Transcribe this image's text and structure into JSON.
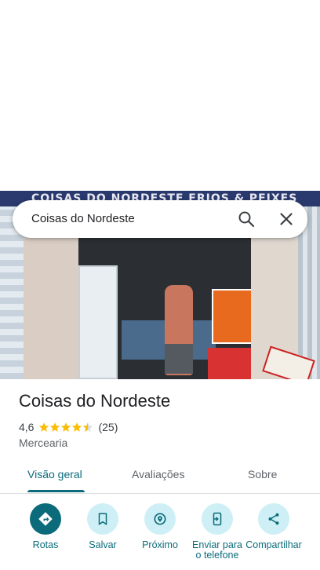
{
  "photo": {
    "sign_text": "COISAS DO NORDESTE FRIOS & PEIXES"
  },
  "search": {
    "query": "Coisas do Nordeste",
    "search_icon": "search-icon",
    "close_icon": "close-icon"
  },
  "place": {
    "title": "Coisas do Nordeste",
    "rating": "4,6",
    "stars": 4.5,
    "reviews": "(25)",
    "category": "Mercearia"
  },
  "tabs": [
    {
      "label": "Visão geral",
      "active": true
    },
    {
      "label": "Avaliações",
      "active": false
    },
    {
      "label": "Sobre",
      "active": false
    }
  ],
  "actions": [
    {
      "label": "Rotas",
      "icon": "directions-icon"
    },
    {
      "label": "Salvar",
      "icon": "bookmark-icon"
    },
    {
      "label": "Próximo",
      "icon": "nearby-icon"
    },
    {
      "label": "Enviar para o telefone",
      "icon": "send-to-phone-icon"
    },
    {
      "label": "Compartilhar",
      "icon": "share-icon"
    }
  ],
  "colors": {
    "accent": "#0b6b7a",
    "action_bg": "#cdeff5",
    "star": "#fbbc04"
  }
}
